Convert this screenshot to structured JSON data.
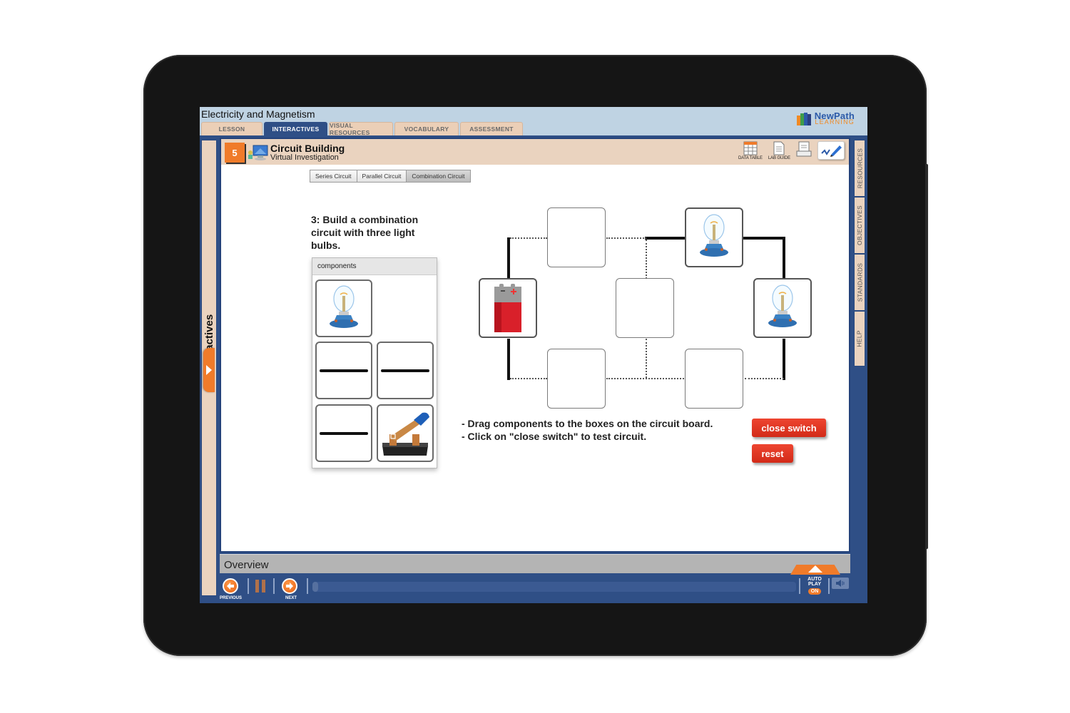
{
  "app": {
    "title": "Electricity and Magnetism",
    "brand": {
      "line1": "NewPath",
      "line2": "LEARNING"
    },
    "tabs": [
      {
        "label": "LESSON",
        "active": false
      },
      {
        "label": "INTERACTIVES",
        "active": true
      },
      {
        "label": "VISUAL RESOURCES",
        "active": false
      },
      {
        "label": "VOCABULARY",
        "active": false
      },
      {
        "label": "ASSESSMENT",
        "active": false
      }
    ]
  },
  "left_panel": {
    "label": "Interactives",
    "expand_icon": "chevron-right-icon"
  },
  "activity": {
    "step_number": "5",
    "title": "Circuit Building",
    "subtitle": "Virtual Investigation",
    "tools": [
      {
        "label": "DATA TABLE",
        "icon": "table-icon"
      },
      {
        "label": "LAB GUIDE",
        "icon": "document-icon"
      },
      {
        "label": "",
        "icon": "printer-icon"
      },
      {
        "label": "",
        "icon": "signature-pen-icon"
      }
    ],
    "subtabs": [
      {
        "label": "Series Circuit",
        "active": false
      },
      {
        "label": "Parallel Circuit",
        "active": false
      },
      {
        "label": "Combination Circuit",
        "active": true
      }
    ],
    "instruction": "3: Build a combination circuit with three light bulbs.",
    "components": {
      "header": "components",
      "items": [
        "light-bulb",
        "wire",
        "wire",
        "wire",
        "switch"
      ]
    },
    "board": {
      "slots": [
        {
          "position": "top-left",
          "content": ""
        },
        {
          "position": "top-right",
          "content": "light-bulb"
        },
        {
          "position": "left",
          "content": "battery"
        },
        {
          "position": "center",
          "content": ""
        },
        {
          "position": "right",
          "content": "light-bulb"
        },
        {
          "position": "bottom-left",
          "content": ""
        },
        {
          "position": "bottom-right",
          "content": ""
        }
      ]
    },
    "directions": [
      "- Drag components to the boxes on the circuit board.",
      "- Click on \"close switch\" to test circuit."
    ],
    "buttons": {
      "close_switch": "close switch",
      "reset": "reset"
    }
  },
  "side_tabs": [
    "RESOURCES",
    "OBJECTIVES",
    "STANDARDS",
    "HELP"
  ],
  "bottom": {
    "overview_label": "Overview",
    "previous_label": "PREVIOUS",
    "next_label": "NEXT",
    "progress": 0,
    "autoplay": {
      "line1": "AUTO",
      "line2": "PLAY",
      "state": "ON"
    }
  },
  "colors": {
    "frame": "#2f4f86",
    "accent_orange": "#f07b2a",
    "tab_beige": "#ead3bf",
    "button_red": "#e03a24"
  }
}
